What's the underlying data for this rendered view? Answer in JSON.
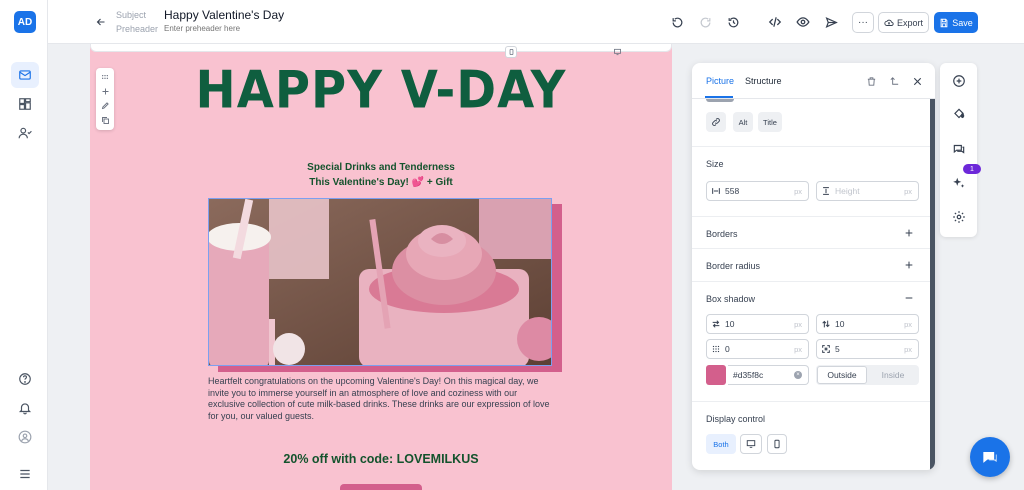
{
  "app": {
    "logo_text": "AD"
  },
  "header": {
    "subject_label": "Subject",
    "subject_value": "Happy Valentine's Day",
    "preheader_label": "Preheader",
    "preheader_placeholder": "Enter preheader here",
    "export_label": "Export",
    "save_label": "Save"
  },
  "email": {
    "headline": "HAPPY V-DAY",
    "subheadline_1": "Special Drinks and Tenderness",
    "subheadline_2": "This Valentine's Day! 💕 + Gift",
    "body_text": "Heartfelt congratulations on the upcoming Valentine's Day! On this magical day, we invite you to immerse yourself in an atmosphere of love and coziness with our exclusive collection of cute milk-based drinks. These drinks are our expression of love for you, our valued guests.",
    "promo": "20% off with code: LOVEMILKUS"
  },
  "panel": {
    "tabs": [
      {
        "label": "Picture"
      },
      {
        "label": "Structure"
      }
    ],
    "chips": {
      "alt": "Alt",
      "title": "Title"
    },
    "size": {
      "title": "Size",
      "width_value": "558",
      "width_unit": "px",
      "height_placeholder": "Height",
      "height_unit": "px"
    },
    "borders_title": "Borders",
    "border_radius_title": "Border radius",
    "box_shadow": {
      "title": "Box shadow",
      "x": "10",
      "y": "10",
      "blur": "0",
      "spread": "5",
      "unit": "px",
      "color": "#d35f8c",
      "mode_outside": "Outside",
      "mode_inside": "Inside"
    },
    "display_control": {
      "title": "Display control",
      "both_label": "Both"
    }
  },
  "right_toolbar": {
    "badge_count": "1"
  },
  "colors": {
    "accent": "#1a73e8",
    "headline": "#0f5e3f",
    "canvas_bg": "#f9c2d0",
    "shadow": "#d35f8c"
  }
}
